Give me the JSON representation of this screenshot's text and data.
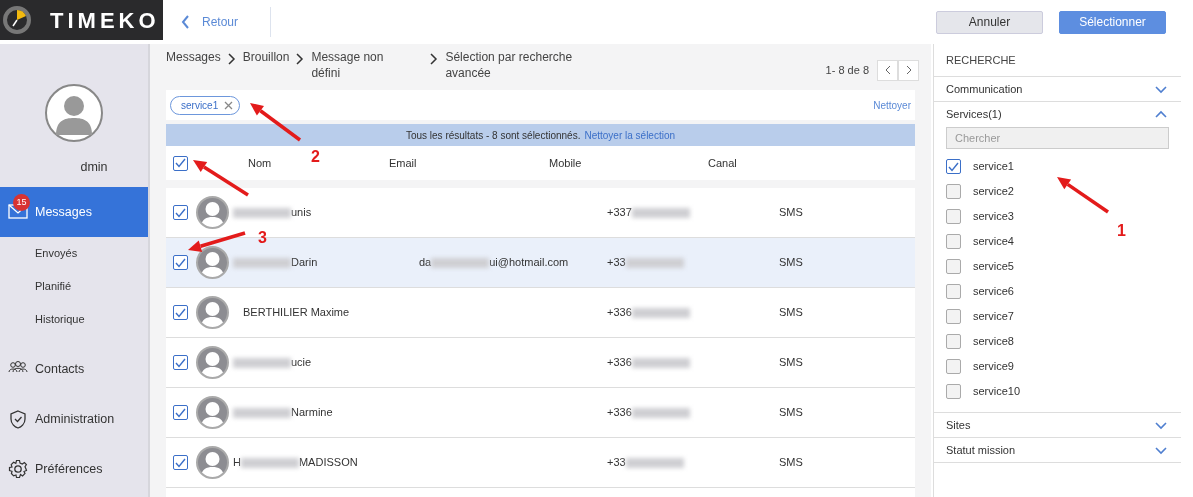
{
  "logo": {
    "text": "TIMEKO"
  },
  "topbar": {
    "back": "Retour",
    "buttons": [
      {
        "label": "Annuler",
        "kind": "secondary"
      },
      {
        "label": "Sélectionner",
        "kind": "primary"
      }
    ]
  },
  "sidebar": {
    "user": "dmin",
    "items": [
      {
        "label": "Messages",
        "badge": "15",
        "selected": true,
        "children": [
          {
            "label": "Envoyés"
          },
          {
            "label": "Planifié"
          },
          {
            "label": "Historique"
          }
        ]
      },
      {
        "label": "Contacts",
        "selected": false
      },
      {
        "label": "Administration",
        "selected": false
      },
      {
        "label": "Préférences",
        "selected": false
      }
    ]
  },
  "breadcrumbs": [
    "Messages",
    "Brouillon",
    "Message non défini",
    "Sélection par recherche avancée"
  ],
  "pagination": {
    "range": "1- 8 de 8"
  },
  "filters": {
    "chips": [
      "service1"
    ],
    "clear": "Nettoyer"
  },
  "banner": {
    "text": "Tous les résultats -  8 sont sélectionnés.",
    "link": "Nettoyer la sélection"
  },
  "table": {
    "all_checked": true,
    "columns": [
      "Nom",
      "Email",
      "Mobile",
      "Canal"
    ],
    "rows": [
      {
        "checked": true,
        "selected": false,
        "name_start": "",
        "name_blurred": true,
        "name_end": "unis",
        "email_start": "",
        "email_blurred": false,
        "email_end": "",
        "mobile_start": "+337",
        "mobile_blurred": true,
        "canal": "SMS"
      },
      {
        "checked": true,
        "selected": true,
        "name_start": "",
        "name_blurred": true,
        "name_end": "Darin",
        "email_start": "da",
        "email_blurred": true,
        "email_end": "ui@hotmail.com",
        "mobile_start": "+33",
        "mobile_blurred": true,
        "canal": "SMS"
      },
      {
        "checked": true,
        "selected": false,
        "name_start": "BERTHILIER Maxime",
        "name_blurred": false,
        "name_end": "",
        "email_start": "",
        "email_blurred": false,
        "email_end": "",
        "mobile_start": "+336",
        "mobile_blurred": true,
        "canal": "SMS"
      },
      {
        "checked": true,
        "selected": false,
        "name_start": "",
        "name_blurred": true,
        "name_end": "ucie",
        "email_start": "",
        "email_blurred": false,
        "email_end": "",
        "mobile_start": "+336",
        "mobile_blurred": true,
        "canal": "SMS"
      },
      {
        "checked": true,
        "selected": false,
        "name_start": "",
        "name_blurred": true,
        "name_end": "Narmine",
        "email_start": "",
        "email_blurred": false,
        "email_end": "",
        "mobile_start": "+336",
        "mobile_blurred": true,
        "canal": "SMS"
      },
      {
        "checked": true,
        "selected": false,
        "name_start": "H",
        "name_blurred": true,
        "name_end": "MADISSON",
        "email_start": "",
        "email_blurred": false,
        "email_end": "",
        "mobile_start": "+33",
        "mobile_blurred": true,
        "canal": "SMS"
      },
      {
        "kind": "cut"
      }
    ]
  },
  "search_panel": {
    "title": "RECHERCHE",
    "sections": [
      {
        "label": "Communication",
        "expanded": false
      },
      {
        "label": "Services(1)",
        "expanded": true,
        "placeholder": "Chercher",
        "options": [
          {
            "label": "service1",
            "checked": true
          },
          {
            "label": "service2",
            "checked": false
          },
          {
            "label": "service3",
            "checked": false
          },
          {
            "label": "service4",
            "checked": false
          },
          {
            "label": "service5",
            "checked": false
          },
          {
            "label": "service6",
            "checked": false
          },
          {
            "label": "service7",
            "checked": false
          },
          {
            "label": "service8",
            "checked": false
          },
          {
            "label": "service9",
            "checked": false
          },
          {
            "label": "service10",
            "checked": false
          }
        ]
      },
      {
        "label": "Sites",
        "expanded": false
      },
      {
        "label": "Statut mission",
        "expanded": false
      }
    ]
  },
  "annotations": [
    {
      "label": "1"
    },
    {
      "label": "2"
    },
    {
      "label": "3"
    }
  ]
}
